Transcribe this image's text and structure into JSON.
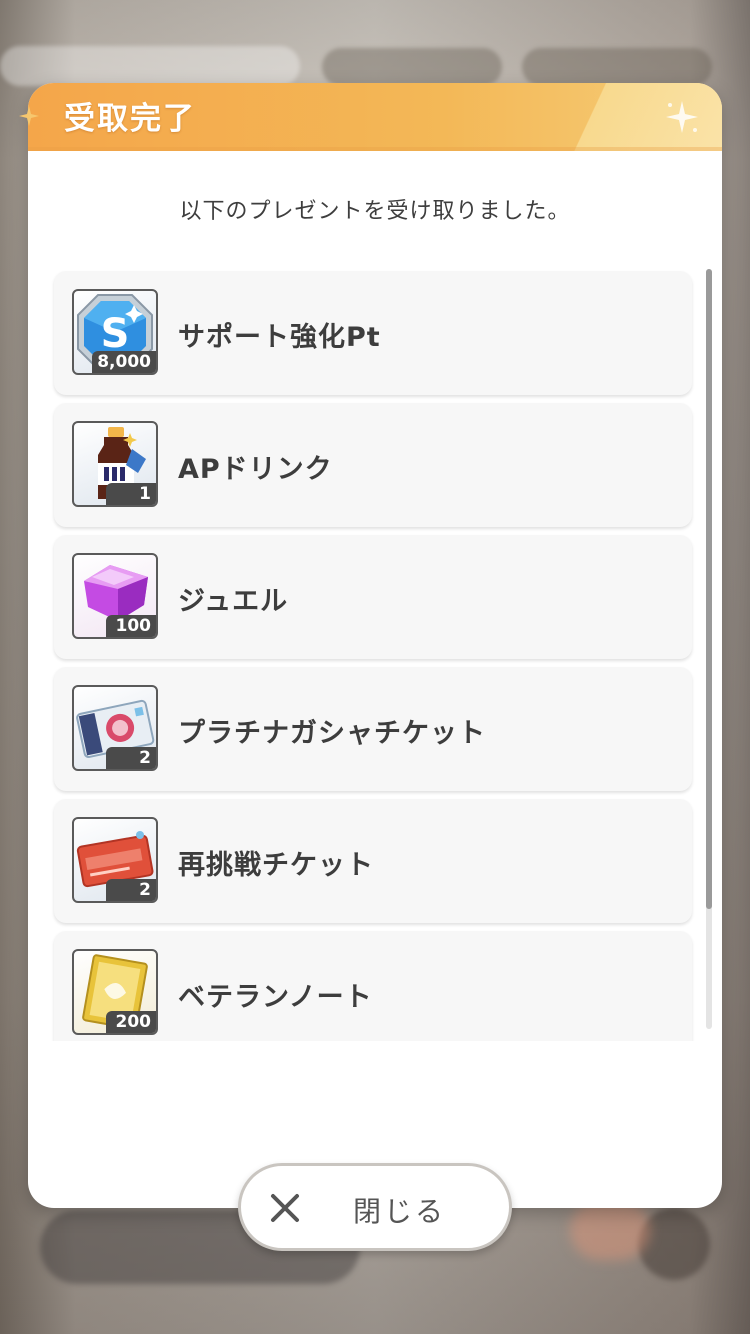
{
  "dialog": {
    "title": "受取完了",
    "message": "以下のプレゼントを受け取りました。",
    "items": [
      {
        "name": "サポート強化Pt",
        "count": "8,000",
        "icon": "support-pt-icon",
        "color": "#3aa0e8"
      },
      {
        "name": "APドリンク",
        "count": "1",
        "icon": "ap-drink-icon",
        "color": "#7a2f1c"
      },
      {
        "name": "ジュエル",
        "count": "100",
        "icon": "jewel-icon",
        "color": "#c04be0"
      },
      {
        "name": "プラチナガシャチケット",
        "count": "2",
        "icon": "platinum-gacha-ticket-icon",
        "color": "#8fb8d8"
      },
      {
        "name": "再挑戦チケット",
        "count": "2",
        "icon": "retry-ticket-icon",
        "color": "#e0503a"
      },
      {
        "name": "ベテランノート",
        "count": "200",
        "icon": "veteran-note-icon",
        "color": "#e8c33a"
      }
    ],
    "close_label": "閉じる"
  },
  "colors": {
    "header_gradient_start": "#f4a64a",
    "header_gradient_end": "#f6cd79",
    "item_background": "#f7f7f7",
    "text_dark": "#3d3d3d",
    "count_badge": "#4a4a4a"
  }
}
